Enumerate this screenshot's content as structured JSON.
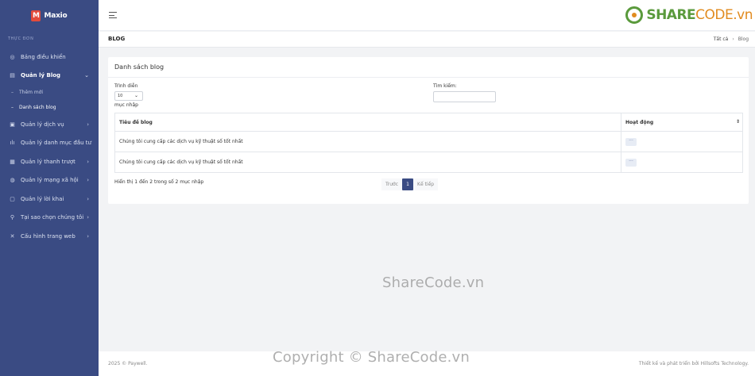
{
  "sidebar": {
    "logo": "Maxio",
    "caption": "THỰC ĐƠN",
    "items": [
      {
        "label": "Bảng điều khiển",
        "icon": "dashboard-icon",
        "glyph": "◎"
      },
      {
        "label": "Quản lý Blog",
        "icon": "blog-icon",
        "glyph": "▤"
      },
      {
        "label": "Quản lý dịch vụ",
        "icon": "services-icon",
        "glyph": "▣"
      },
      {
        "label": "Quản lý danh mục đầu tư",
        "icon": "chart-icon",
        "glyph": "ılı"
      },
      {
        "label": "Quản lý thanh trượt",
        "icon": "slider-icon",
        "glyph": "▦"
      },
      {
        "label": "Quản lý mạng xã hội",
        "icon": "social-icon",
        "glyph": "◍"
      },
      {
        "label": "Quản lý lời khai",
        "icon": "testimonial-icon",
        "glyph": "▢"
      },
      {
        "label": "Tại sao chọn chúng tôi",
        "icon": "why-icon",
        "glyph": "⚲"
      },
      {
        "label": "Cấu hình trang web",
        "icon": "tools-icon",
        "glyph": "✕"
      }
    ],
    "blog_sub": [
      "Thêm mới",
      "Danh sách blog"
    ]
  },
  "header": {
    "brand_share": "SHARE",
    "brand_code": "CODE.vn"
  },
  "page": {
    "title": "BLOG",
    "breadcrumb_all": "Tất cả",
    "breadcrumb_sep": "›",
    "breadcrumb_current": "Blog"
  },
  "card": {
    "title": "Danh sách blog",
    "show_label": "Trình diễn",
    "show_value": "10",
    "show_suffix": "mục nhập",
    "search_label": "Tìm kiếm:"
  },
  "table": {
    "headers": [
      "Tiêu đề blog",
      "Hoạt động"
    ],
    "rows": [
      {
        "title": "Chúng tôi cung cấp các dịch vụ kỹ thuật số tốt nhất",
        "action": "···"
      },
      {
        "title": "Chúng tôi cung cấp các dịch vụ kỹ thuật số tốt nhất",
        "action": "···"
      }
    ]
  },
  "pagination": {
    "info": "Hiển thị 1 đến 2 trong số 2 mục nhập",
    "prev": "Trước",
    "page": "1",
    "next": "Kế tiếp"
  },
  "watermarks": {
    "mid": "ShareCode.vn",
    "bottom": "Copyright © ShareCode.vn"
  },
  "footer": {
    "copyright": "2025 © Paywell.",
    "credit": "Thiết kế và phát triển bởi Hillsofts Technology."
  },
  "colors": {
    "sidebar": "#3a4b83",
    "brand_green": "#5a9a3c",
    "brand_orange": "#e18b1f"
  }
}
